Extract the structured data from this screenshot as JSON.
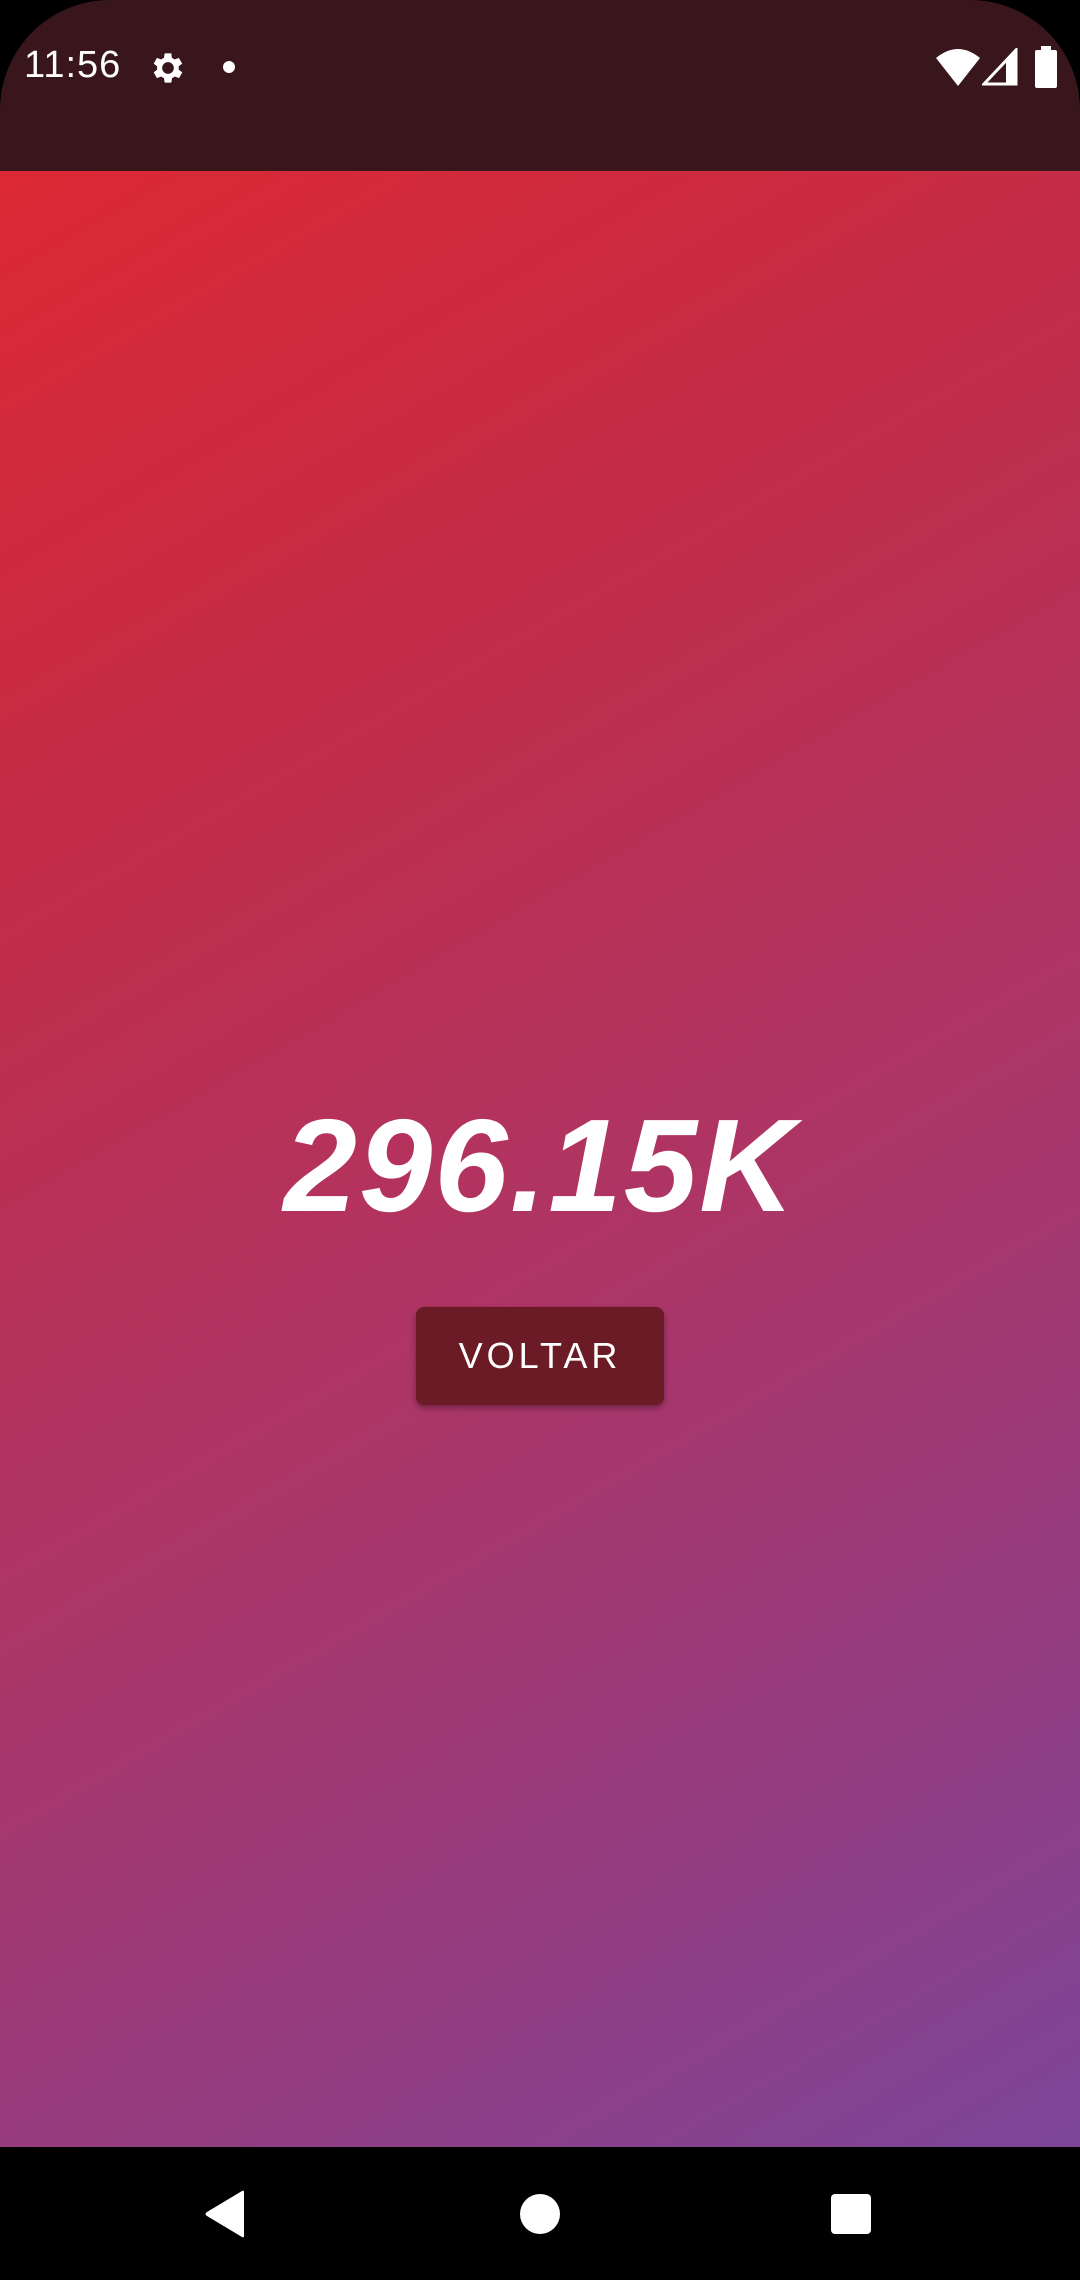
{
  "status_bar": {
    "time": "11:56",
    "icons": [
      "gear-icon",
      "notification-dot-icon",
      "wifi-icon",
      "cellular-signal-icon",
      "battery-icon"
    ]
  },
  "main": {
    "counter_value": "296.15K",
    "back_button_label": "VOLTAR"
  },
  "nav_bar": {
    "buttons": [
      "back-nav-icon",
      "home-nav-icon",
      "recents-nav-icon"
    ]
  },
  "colors": {
    "status_bar_bg": "#38161b",
    "gradient_start": "#dc2834",
    "gradient_end": "#7c4598",
    "button_bg": "#6b1b25",
    "text": "#ffffff"
  }
}
